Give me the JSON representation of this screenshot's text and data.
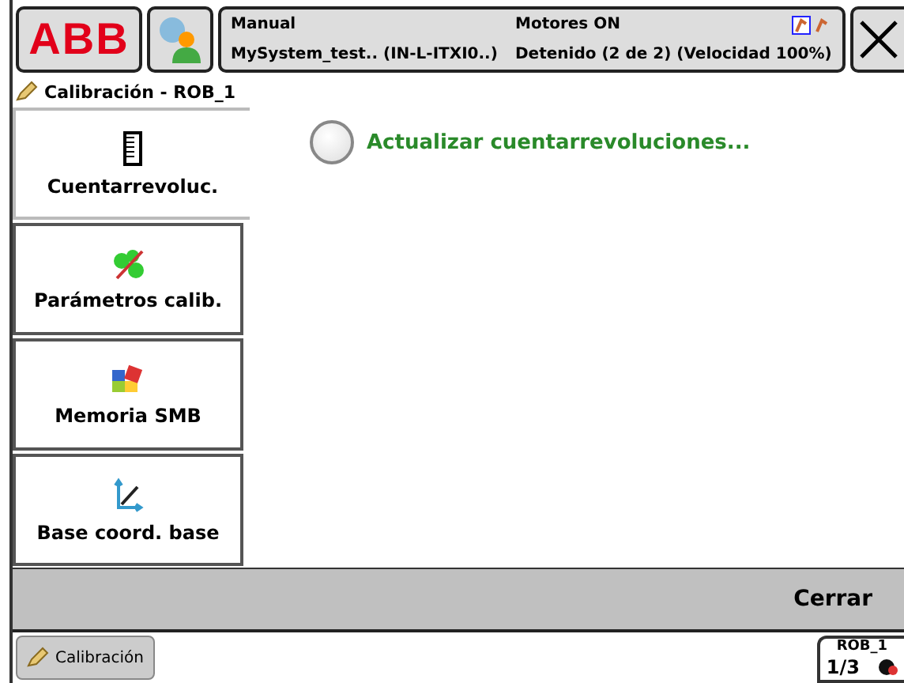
{
  "header": {
    "logo": "ABB",
    "mode": "Manual",
    "system": "MySystem_test.. (IN-L-ITXI0..)",
    "motors": "Motores ON",
    "state": "Detenido (2 de 2) (Velocidad 100%)"
  },
  "window": {
    "title": "Calibración - ROB_1"
  },
  "tabs": [
    {
      "label": "Cuentarrevoluc.",
      "kind": "ruler",
      "selected": true
    },
    {
      "label": "Parámetros calib.",
      "kind": "gears",
      "selected": false
    },
    {
      "label": "Memoria SMB",
      "kind": "memory",
      "selected": false
    },
    {
      "label": "Base coord. base",
      "kind": "axes",
      "selected": false
    }
  ],
  "options": [
    {
      "label": "Actualizar cuentarrevoluciones...",
      "selected": false
    }
  ],
  "command_bar": {
    "close": "Cerrar"
  },
  "taskbar": {
    "app": "Calibración",
    "unit": "ROB_1",
    "increment": "1/3"
  }
}
